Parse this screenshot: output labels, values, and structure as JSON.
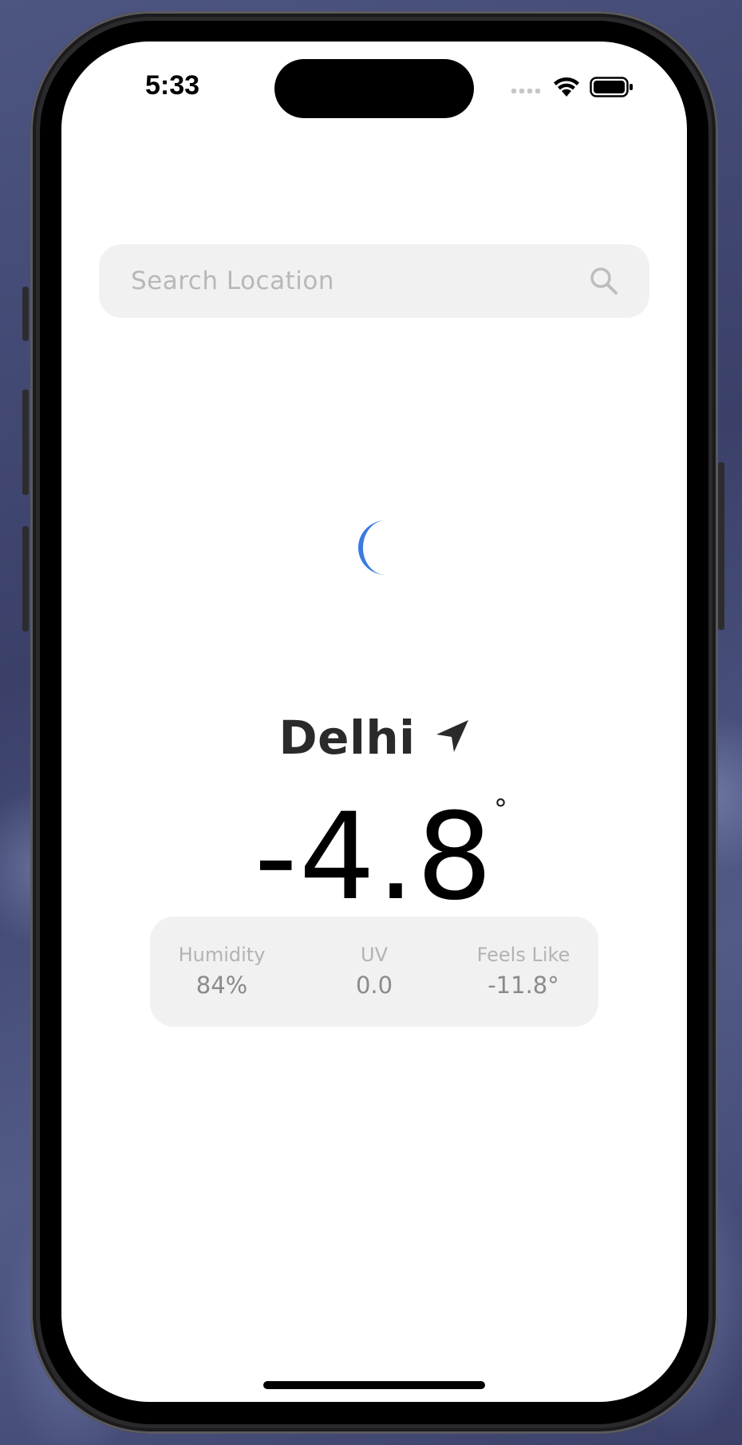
{
  "status_bar": {
    "time": "5:33"
  },
  "search": {
    "placeholder": "Search Location",
    "value": ""
  },
  "weather": {
    "condition_icon": "moon-icon",
    "city": "Delhi",
    "location_icon": "location-arrow-icon",
    "temperature": "-4.8",
    "degree_symbol": "°"
  },
  "stats": [
    {
      "label": "Humidity",
      "value": "84%"
    },
    {
      "label": "UV",
      "value": "0.0"
    },
    {
      "label": "Feels Like",
      "value": "-11.8°"
    }
  ],
  "colors": {
    "moon": "#3a7be0",
    "card_bg": "#f1f1f1",
    "screen_bg": "#ffffff"
  }
}
